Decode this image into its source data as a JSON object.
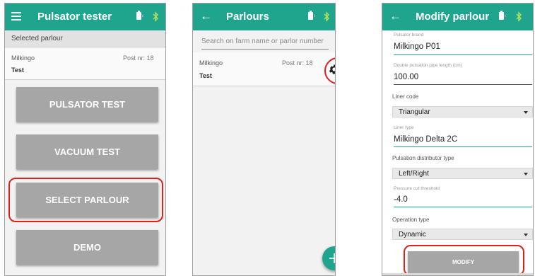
{
  "colors": {
    "accent": "#1fa48e",
    "highlight": "#e01f1f",
    "button_gray": "#a6a6a6"
  },
  "screen1": {
    "title": "Pulsator tester",
    "selected_parlour_label": "Selected parlour",
    "parlour": {
      "farm": "Milkingo",
      "post": "Post nr: 18",
      "name": "Test"
    },
    "buttons": [
      "PULSATOR TEST",
      "VACUUM TEST",
      "SELECT PARLOUR",
      "DEMO"
    ],
    "highlighted_button": "SELECT PARLOUR"
  },
  "screen2": {
    "title": "Parlours",
    "search_placeholder": "Search on farm name or parlor number",
    "parlour": {
      "farm": "Milkingo",
      "post": "Post nr: 18",
      "name": "Test"
    },
    "fab_icon": "plus-icon",
    "settings_icon": "gear-icon"
  },
  "screen3": {
    "title": "Modify parlour",
    "fields": {
      "pulsator_brand": {
        "label": "Pulsator brand",
        "value": "Milkingo P01"
      },
      "pipe_length": {
        "label": "Double pulsation pipe length (cm)",
        "value": "100.00"
      },
      "liner_code": {
        "label": "Liner code",
        "value": "Triangular"
      },
      "liner_type": {
        "label": "Liner type",
        "value": "Milkingo Delta 2C"
      },
      "distributor_type": {
        "label": "Pulsation distributor type",
        "value": "Left/Right"
      },
      "pressure_threshold": {
        "label": "Pressure cut threshold",
        "value": "-4.0"
      },
      "operation_type": {
        "label": "Operation type",
        "value": "Dynamic"
      }
    },
    "modify_label": "MODIFY"
  }
}
